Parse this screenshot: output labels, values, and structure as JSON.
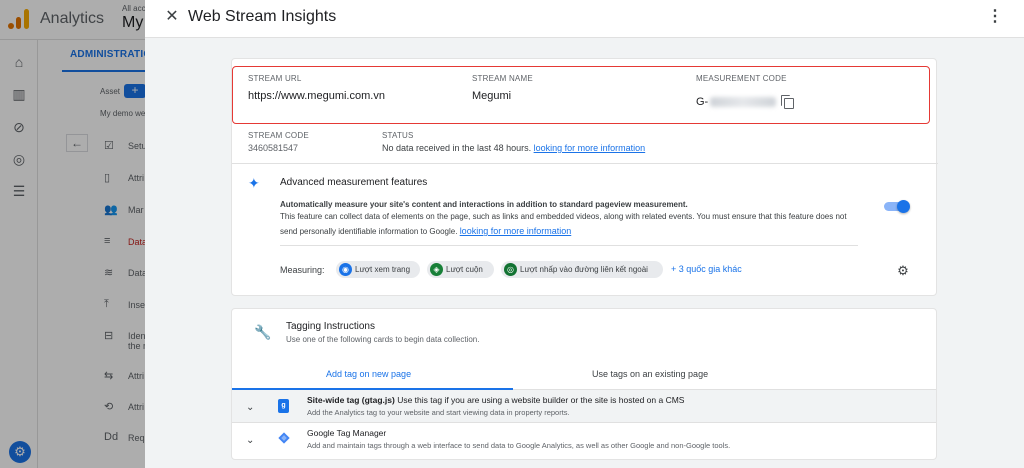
{
  "app": {
    "product_name": "Analytics",
    "account_small": "All acc",
    "account_big": "My",
    "admin_tab": "ADMINISTRATION",
    "asset_label": "Asset",
    "asset_button": "+",
    "demo_label": "My demo web",
    "back_icon": "←",
    "menu_items": [
      {
        "icon": "☑",
        "label": "Setu"
      },
      {
        "icon": "▯",
        "label": "Attri"
      },
      {
        "icon": "👥",
        "label": "Mar"
      },
      {
        "icon": "≡",
        "label": "Data"
      },
      {
        "icon": "≋",
        "label": "Data"
      },
      {
        "icon": "⤒",
        "label": "Inse"
      },
      {
        "icon": "⊟",
        "label": "Iden"
      },
      {
        "icon": "⇆",
        "label": "Attri"
      },
      {
        "icon": "⟲",
        "label": "Attri"
      },
      {
        "icon": "Dd",
        "label": "Requ"
      }
    ],
    "menu_extra": "the n"
  },
  "panel": {
    "title": "Web Stream Insights",
    "close_icon": "✕",
    "more_icon": "⋮"
  },
  "stream": {
    "url_label": "STREAM URL",
    "url_value": "https://www.megumi.com.vn",
    "name_label": "STREAM NAME",
    "name_value": "Megumi",
    "code_label": "MEASUREMENT CODE",
    "code_prefix": "G-",
    "stream_code_label": "STREAM CODE",
    "stream_code_value": "3460581547",
    "status_label": "STATUS",
    "status_text": "No data received in the last 48 hours.",
    "status_link": "looking for more information"
  },
  "advanced": {
    "title": "Advanced measurement features",
    "bold_line": "Automatically measure your site's content and interactions in addition to standard pageview measurement.",
    "desc": "This feature can collect data of elements on the page, such as links and embedded videos, along with related events. You must ensure that this feature does not send personally identifiable information to Google.",
    "desc_link": "looking for more information",
    "toggle_on": true,
    "measuring_label": "Measuring:",
    "chips": [
      {
        "label": "Lượt xem trang",
        "icon": "◉",
        "color": "#1a73e8"
      },
      {
        "label": "Lượt cuộn",
        "icon": "◈",
        "color": "#188038"
      },
      {
        "label": "Lượt nhấp vào đường liên kết ngoài",
        "icon": "◎",
        "color": "#137333"
      }
    ],
    "more_countries": "+ 3 quốc gia khác"
  },
  "tagging": {
    "title": "Tagging Instructions",
    "subtitle": "Use one of the following cards to begin data collection.",
    "tabs": [
      {
        "label": "Add tag on new page",
        "active": true
      },
      {
        "label": "Use tags on an existing page",
        "active": false
      }
    ],
    "rows": [
      {
        "title_bold": "Site-wide tag (gtag.js)",
        "title_rest": " Use this tag if you are using a website builder or the site is hosted on a CMS",
        "sub": "Add the Analytics tag to your website and start viewing data in property reports.",
        "icon_text": "g"
      },
      {
        "title_bold": "",
        "title_rest": "Google Tag Manager",
        "sub": "Add and maintain tags through a web interface to send data to Google Analytics, as well as other Google and non-Google tools.",
        "icon_text": ""
      }
    ]
  }
}
